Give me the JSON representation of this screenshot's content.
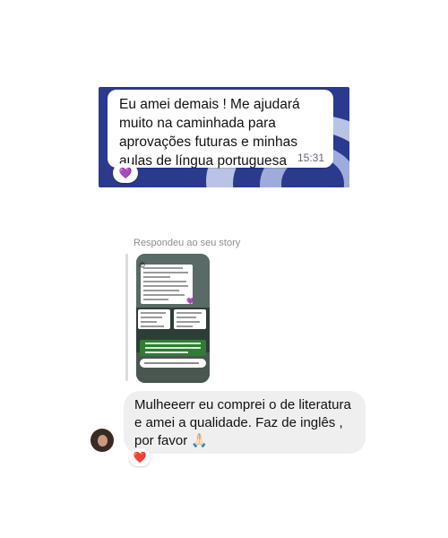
{
  "whatsapp_card": {
    "message": "Eu amei demais ! Me ajudará muito na caminhada para aprovações futuras e minhas aulas de língua portuguesa",
    "time": "15:31",
    "reaction": "💜"
  },
  "story_reply": {
    "label": "Respondeu ao seu story"
  },
  "incoming_message": {
    "text": "Mulheeerr eu comprei o de literatura e amei a qualidade. Faz de inglês , por favor 🙏🏻",
    "reaction": "❤️"
  },
  "colors": {
    "card_background": "#2b3a8c",
    "incoming_bubble": "#efefef",
    "muted_text": "#8e8e8e"
  }
}
